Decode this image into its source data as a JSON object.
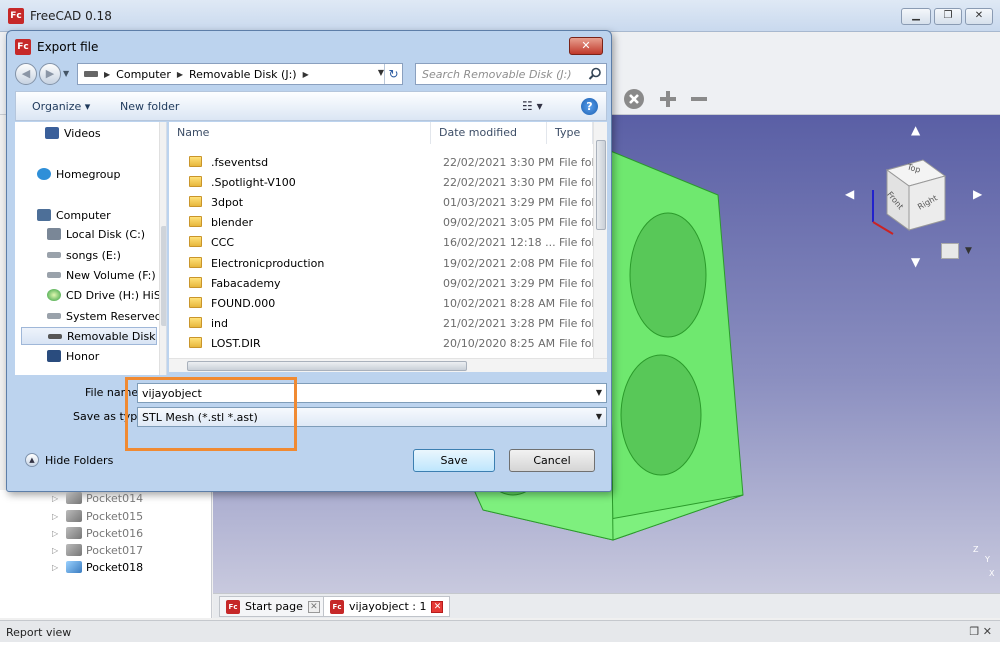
{
  "app": {
    "title": "FreeCAD 0.18",
    "logo": "Fc"
  },
  "dialog": {
    "title": "Export file",
    "address": {
      "computer": "Computer",
      "drive": "Removable Disk (J:)"
    },
    "search_placeholder": "Search Removable Disk (J:)",
    "toolbar": {
      "organize": "Organize ▾",
      "new_folder": "New folder"
    },
    "nav_items": [
      {
        "label": "Videos",
        "icon": "video-icon"
      },
      {
        "label": "Homegroup",
        "icon": "homegroup-icon"
      },
      {
        "label": "Computer",
        "icon": "computer-icon"
      },
      {
        "label": "Local Disk (C:)",
        "icon": "local-disk-icon"
      },
      {
        "label": "songs  (E:)",
        "icon": "drive-icon"
      },
      {
        "label": "New Volume (F:)",
        "icon": "drive-icon"
      },
      {
        "label": "CD Drive (H:) HiS",
        "icon": "cd-drive-icon"
      },
      {
        "label": "System Reserved",
        "icon": "drive-icon"
      },
      {
        "label": "Removable Disk (",
        "icon": "removable-disk-icon"
      },
      {
        "label": "Honor",
        "icon": "phone-icon"
      }
    ],
    "columns": {
      "name": "Name",
      "date": "Date modified",
      "type": "Type"
    },
    "files": [
      {
        "name": ".fseventsd",
        "date": "22/02/2021 3:30 PM",
        "type": "File fol"
      },
      {
        "name": ".Spotlight-V100",
        "date": "22/02/2021 3:30 PM",
        "type": "File fol"
      },
      {
        "name": "3dpot",
        "date": "01/03/2021 3:29 PM",
        "type": "File fol"
      },
      {
        "name": "blender",
        "date": "09/02/2021 3:05 PM",
        "type": "File fol"
      },
      {
        "name": "CCC",
        "date": "16/02/2021 12:18 ...",
        "type": "File fol"
      },
      {
        "name": "Electronicproduction",
        "date": "19/02/2021 2:08 PM",
        "type": "File fol"
      },
      {
        "name": "Fabacademy",
        "date": "09/02/2021 3:29 PM",
        "type": "File fol"
      },
      {
        "name": "FOUND.000",
        "date": "10/02/2021 8:28 AM",
        "type": "File fol"
      },
      {
        "name": "ind",
        "date": "21/02/2021 3:28 PM",
        "type": "File fol"
      },
      {
        "name": "LOST.DIR",
        "date": "20/10/2020 8:25 AM",
        "type": "File fol"
      }
    ],
    "file_name_label": "File name:",
    "file_name_value": "vijayobject",
    "save_type_label": "Save as type:",
    "save_type_value": "STL Mesh (*.stl *.ast)",
    "hide_folders": "Hide Folders",
    "save_button": "Save",
    "cancel_button": "Cancel",
    "close_glyph": "✕"
  },
  "tree_items": [
    {
      "label": "Pocket014",
      "active": false
    },
    {
      "label": "Pocket015",
      "active": false
    },
    {
      "label": "Pocket016",
      "active": false
    },
    {
      "label": "Pocket017",
      "active": false
    },
    {
      "label": "Pocket018",
      "active": true
    }
  ],
  "navcube": {
    "top": "Top",
    "front": "Front",
    "right": "Right"
  },
  "axis": {
    "x": "X",
    "y": "Y",
    "z": "Z"
  },
  "tabs": [
    {
      "label": "Start page",
      "active": false
    },
    {
      "label": "vijayobject : 1",
      "active": true
    }
  ],
  "report_view": "Report view",
  "colors": {
    "model_green": "#7ef07e",
    "highlight_orange": "#f08a32",
    "viewport_top": "#5a5fa5"
  }
}
